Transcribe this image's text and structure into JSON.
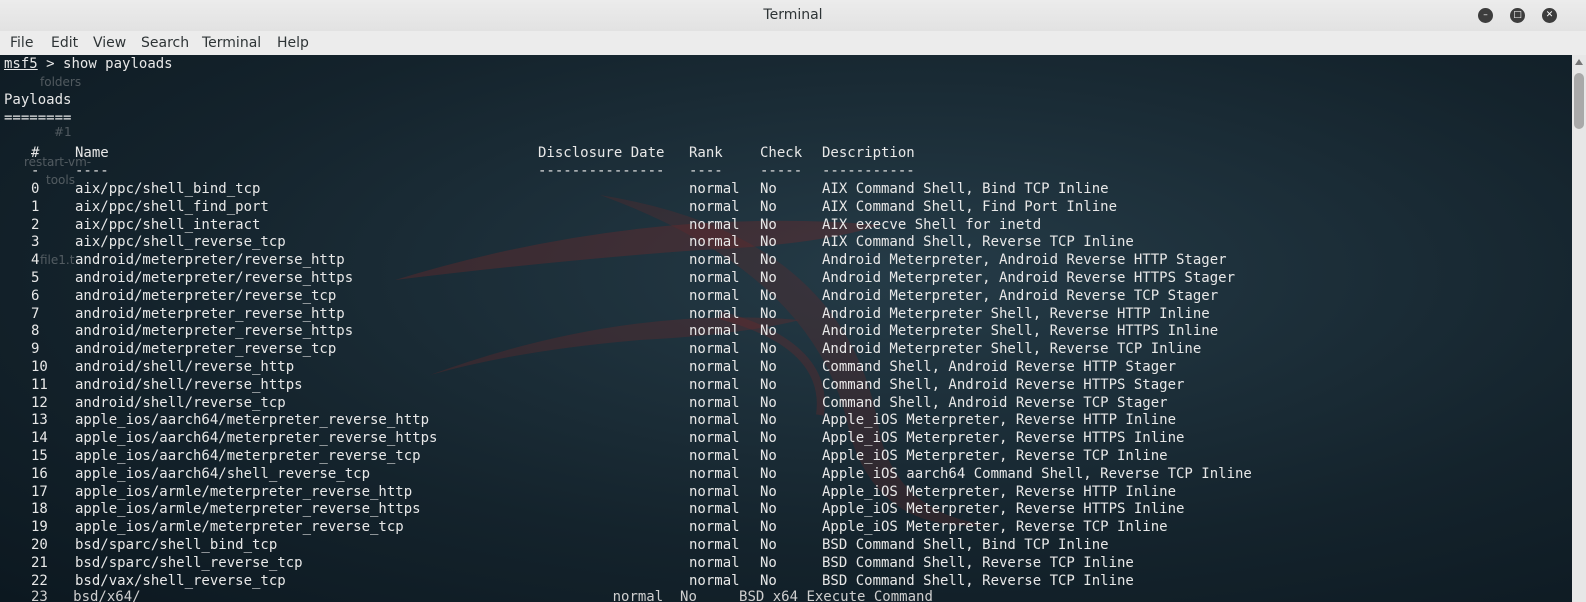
{
  "window": {
    "title": "Terminal"
  },
  "menu": [
    "File",
    "Edit",
    "View",
    "Search",
    "Terminal",
    "Help"
  ],
  "prompt": {
    "name": "msf5",
    "separator": ">",
    "command": "show payloads"
  },
  "section": {
    "title": "Payloads",
    "underline": "========"
  },
  "table": {
    "headers": {
      "num": "#",
      "name": "Name",
      "date": "Disclosure Date",
      "rank": "Rank",
      "check": "Check",
      "desc": "Description"
    },
    "underlines": {
      "num": "-",
      "name": "----",
      "date": "---------------",
      "rank": "----",
      "check": "-----",
      "desc": "-----------"
    },
    "rows": [
      {
        "num": "0",
        "name": "aix/ppc/shell_bind_tcp",
        "rank": "normal",
        "check": "No",
        "desc": "AIX Command Shell, Bind TCP Inline"
      },
      {
        "num": "1",
        "name": "aix/ppc/shell_find_port",
        "rank": "normal",
        "check": "No",
        "desc": "AIX Command Shell, Find Port Inline"
      },
      {
        "num": "2",
        "name": "aix/ppc/shell_interact",
        "rank": "normal",
        "check": "No",
        "desc": "AIX execve Shell for inetd"
      },
      {
        "num": "3",
        "name": "aix/ppc/shell_reverse_tcp",
        "rank": "normal",
        "check": "No",
        "desc": "AIX Command Shell, Reverse TCP Inline"
      },
      {
        "num": "4",
        "name": "android/meterpreter/reverse_http",
        "rank": "normal",
        "check": "No",
        "desc": "Android Meterpreter, Android Reverse HTTP Stager"
      },
      {
        "num": "5",
        "name": "android/meterpreter/reverse_https",
        "rank": "normal",
        "check": "No",
        "desc": "Android Meterpreter, Android Reverse HTTPS Stager"
      },
      {
        "num": "6",
        "name": "android/meterpreter/reverse_tcp",
        "rank": "normal",
        "check": "No",
        "desc": "Android Meterpreter, Android Reverse TCP Stager"
      },
      {
        "num": "7",
        "name": "android/meterpreter_reverse_http",
        "rank": "normal",
        "check": "No",
        "desc": "Android Meterpreter Shell, Reverse HTTP Inline"
      },
      {
        "num": "8",
        "name": "android/meterpreter_reverse_https",
        "rank": "normal",
        "check": "No",
        "desc": "Android Meterpreter Shell, Reverse HTTPS Inline"
      },
      {
        "num": "9",
        "name": "android/meterpreter_reverse_tcp",
        "rank": "normal",
        "check": "No",
        "desc": "Android Meterpreter Shell, Reverse TCP Inline"
      },
      {
        "num": "10",
        "name": "android/shell/reverse_http",
        "rank": "normal",
        "check": "No",
        "desc": "Command Shell, Android Reverse HTTP Stager"
      },
      {
        "num": "11",
        "name": "android/shell/reverse_https",
        "rank": "normal",
        "check": "No",
        "desc": "Command Shell, Android Reverse HTTPS Stager"
      },
      {
        "num": "12",
        "name": "android/shell/reverse_tcp",
        "rank": "normal",
        "check": "No",
        "desc": "Command Shell, Android Reverse TCP Stager"
      },
      {
        "num": "13",
        "name": "apple_ios/aarch64/meterpreter_reverse_http",
        "rank": "normal",
        "check": "No",
        "desc": "Apple_iOS Meterpreter, Reverse HTTP Inline"
      },
      {
        "num": "14",
        "name": "apple_ios/aarch64/meterpreter_reverse_https",
        "rank": "normal",
        "check": "No",
        "desc": "Apple_iOS Meterpreter, Reverse HTTPS Inline"
      },
      {
        "num": "15",
        "name": "apple_ios/aarch64/meterpreter_reverse_tcp",
        "rank": "normal",
        "check": "No",
        "desc": "Apple_iOS Meterpreter, Reverse TCP Inline"
      },
      {
        "num": "16",
        "name": "apple_ios/aarch64/shell_reverse_tcp",
        "rank": "normal",
        "check": "No",
        "desc": "Apple iOS aarch64 Command Shell, Reverse TCP Inline"
      },
      {
        "num": "17",
        "name": "apple_ios/armle/meterpreter_reverse_http",
        "rank": "normal",
        "check": "No",
        "desc": "Apple_iOS Meterpreter, Reverse HTTP Inline"
      },
      {
        "num": "18",
        "name": "apple_ios/armle/meterpreter_reverse_https",
        "rank": "normal",
        "check": "No",
        "desc": "Apple_iOS Meterpreter, Reverse HTTPS Inline"
      },
      {
        "num": "19",
        "name": "apple_ios/armle/meterpreter_reverse_tcp",
        "rank": "normal",
        "check": "No",
        "desc": "Apple_iOS Meterpreter, Reverse TCP Inline"
      },
      {
        "num": "20",
        "name": "bsd/sparc/shell_bind_tcp",
        "rank": "normal",
        "check": "No",
        "desc": "BSD Command Shell, Bind TCP Inline"
      },
      {
        "num": "21",
        "name": "bsd/sparc/shell_reverse_tcp",
        "rank": "normal",
        "check": "No",
        "desc": "BSD Command Shell, Reverse TCP Inline"
      },
      {
        "num": "22",
        "name": "bsd/vax/shell_reverse_tcp",
        "rank": "normal",
        "check": "No",
        "desc": "BSD Command Shell, Reverse TCP Inline"
      }
    ]
  },
  "desktop_ghosts": [
    "folders",
    "#1",
    "restart-vm-",
    "tools",
    "file1.t"
  ],
  "colors": {
    "background": "#14232c",
    "text": "#e8e8e8",
    "titlebar": "#ececec"
  },
  "icons": {
    "minimize": "minimize-icon",
    "maximize": "maximize-icon",
    "close": "close-icon"
  }
}
